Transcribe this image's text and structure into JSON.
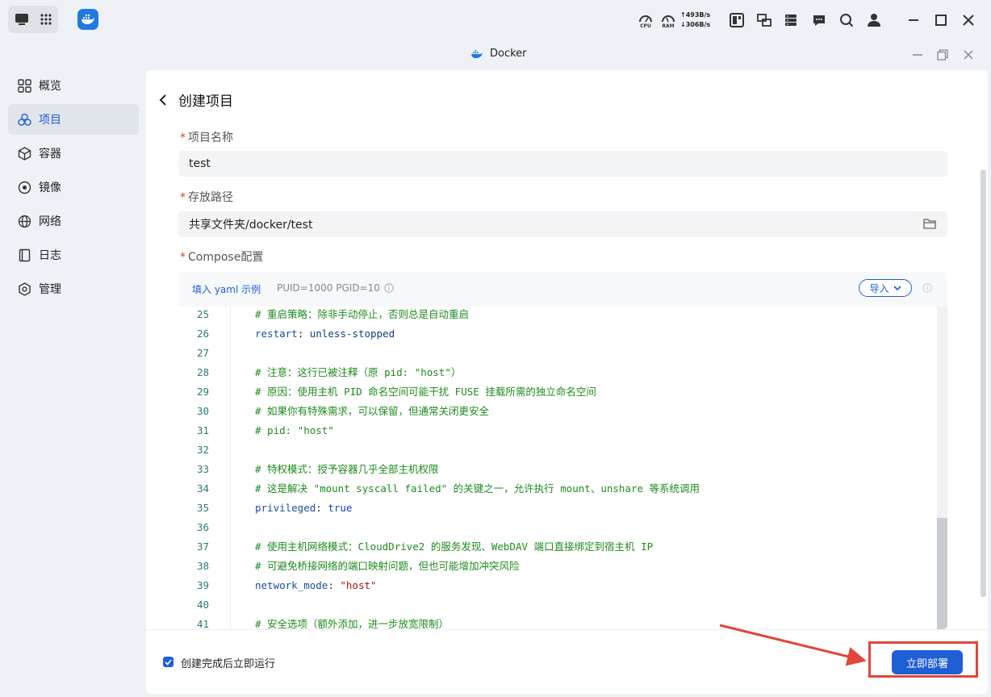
{
  "window": {
    "title": "Docker"
  },
  "topbar": {
    "cpu_label": "CPU",
    "ram_label": "RAM",
    "net_up": "493B/s",
    "net_down": "306B/s"
  },
  "sidebar": {
    "items": [
      {
        "label": "概览",
        "icon": "grid-icon",
        "active": false
      },
      {
        "label": "项目",
        "icon": "cluster-icon",
        "active": true
      },
      {
        "label": "容器",
        "icon": "cube-icon",
        "active": false
      },
      {
        "label": "镜像",
        "icon": "disc-icon",
        "active": false
      },
      {
        "label": "网络",
        "icon": "globe-icon",
        "active": false
      },
      {
        "label": "日志",
        "icon": "book-icon",
        "active": false
      },
      {
        "label": "管理",
        "icon": "hexagon-settings-icon",
        "active": false
      }
    ]
  },
  "form": {
    "title": "创建项目",
    "required_mark": "*",
    "name_label": "项目名称",
    "name_value": "test",
    "path_label": "存放路径",
    "path_value": "共享文件夹/docker/test",
    "compose_label": "Compose配置",
    "yaml_example_link": "填入 yaml 示例",
    "ids_text": "PUID=1000 PGID=10",
    "import_button": "导入"
  },
  "editor": {
    "lines": [
      {
        "num": "25",
        "parts": [
          {
            "t": "# 重启策略：除非手动停止，否则总是自动重启",
            "c": "com"
          }
        ]
      },
      {
        "num": "26",
        "parts": [
          {
            "t": "restart",
            "c": "key"
          },
          {
            "t": ": ",
            "c": ""
          },
          {
            "t": "unless-stopped",
            "c": "val"
          }
        ]
      },
      {
        "num": "27",
        "parts": []
      },
      {
        "num": "28",
        "parts": [
          {
            "t": "# 注意：这行已被注释（原 pid: \"host\"）",
            "c": "com"
          }
        ]
      },
      {
        "num": "29",
        "parts": [
          {
            "t": "# 原因：使用主机 PID 命名空间可能干扰 FUSE 挂载所需的独立命名空间",
            "c": "com"
          }
        ]
      },
      {
        "num": "30",
        "parts": [
          {
            "t": "# 如果你有特殊需求，可以保留，但通常关闭更安全",
            "c": "com"
          }
        ]
      },
      {
        "num": "31",
        "parts": [
          {
            "t": "# pid: \"host\"",
            "c": "com"
          }
        ]
      },
      {
        "num": "32",
        "parts": []
      },
      {
        "num": "33",
        "parts": [
          {
            "t": "# 特权模式：授予容器几乎全部主机权限",
            "c": "com"
          }
        ]
      },
      {
        "num": "34",
        "parts": [
          {
            "t": "# 这是解决 \"mount syscall failed\" 的关键之一，允许执行 mount、unshare 等系统调用",
            "c": "com"
          }
        ]
      },
      {
        "num": "35",
        "parts": [
          {
            "t": "privileged",
            "c": "key"
          },
          {
            "t": ": ",
            "c": ""
          },
          {
            "t": "true",
            "c": "kw"
          }
        ]
      },
      {
        "num": "36",
        "parts": []
      },
      {
        "num": "37",
        "parts": [
          {
            "t": "# 使用主机网络模式：CloudDrive2 的服务发现、WebDAV 端口直接绑定到宿主机 IP",
            "c": "com"
          }
        ]
      },
      {
        "num": "38",
        "parts": [
          {
            "t": "# 可避免桥接网络的端口映射问题，但也可能增加冲突风险",
            "c": "com"
          }
        ]
      },
      {
        "num": "39",
        "parts": [
          {
            "t": "network_mode",
            "c": "key"
          },
          {
            "t": ": ",
            "c": ""
          },
          {
            "t": "\"host\"",
            "c": "str"
          }
        ]
      },
      {
        "num": "40",
        "parts": []
      },
      {
        "num": "41",
        "parts": [
          {
            "t": "# 安全选项（额外添加，进一步放宽限制）",
            "c": "com"
          }
        ]
      }
    ]
  },
  "footer": {
    "run_after_create_label": "创建完成后立即运行",
    "run_after_create_checked": true,
    "deploy_button": "立即部署"
  },
  "colors": {
    "accent": "#1f5fd6",
    "highlight": "#e0463c",
    "comment": "#1f8a1f"
  }
}
